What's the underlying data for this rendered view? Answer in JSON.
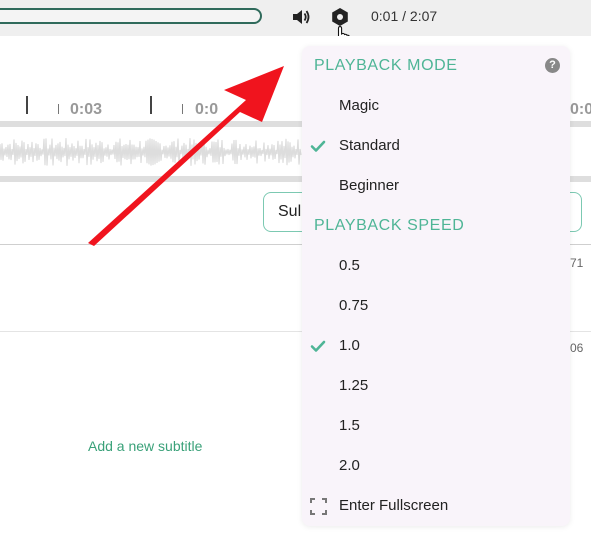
{
  "player": {
    "time": "0:01 / 2:07",
    "volume_icon": "speaker-icon",
    "settings_icon": "gear-icon"
  },
  "timeline": {
    "labels": [
      "0:03",
      "0:0",
      "0:0"
    ]
  },
  "editor": {
    "subtitle_input_value": "Sul",
    "edge_numbers": [
      "71",
      "06"
    ],
    "add_subtitle_label": "Add a new subtitle"
  },
  "menu": {
    "playback_mode_header": "PLAYBACK MODE",
    "help_symbol": "?",
    "modes": [
      {
        "label": "Magic",
        "checked": false
      },
      {
        "label": "Standard",
        "checked": true
      },
      {
        "label": "Beginner",
        "checked": false
      }
    ],
    "playback_speed_header": "PLAYBACK SPEED",
    "speeds": [
      {
        "label": "0.5",
        "checked": false
      },
      {
        "label": "0.75",
        "checked": false
      },
      {
        "label": "1.0",
        "checked": true
      },
      {
        "label": "1.25",
        "checked": false
      },
      {
        "label": "1.5",
        "checked": false
      },
      {
        "label": "2.0",
        "checked": false
      }
    ],
    "fullscreen_label": "Enter Fullscreen"
  },
  "colors": {
    "accent": "#4fb596",
    "arrow": "#f0141e"
  }
}
